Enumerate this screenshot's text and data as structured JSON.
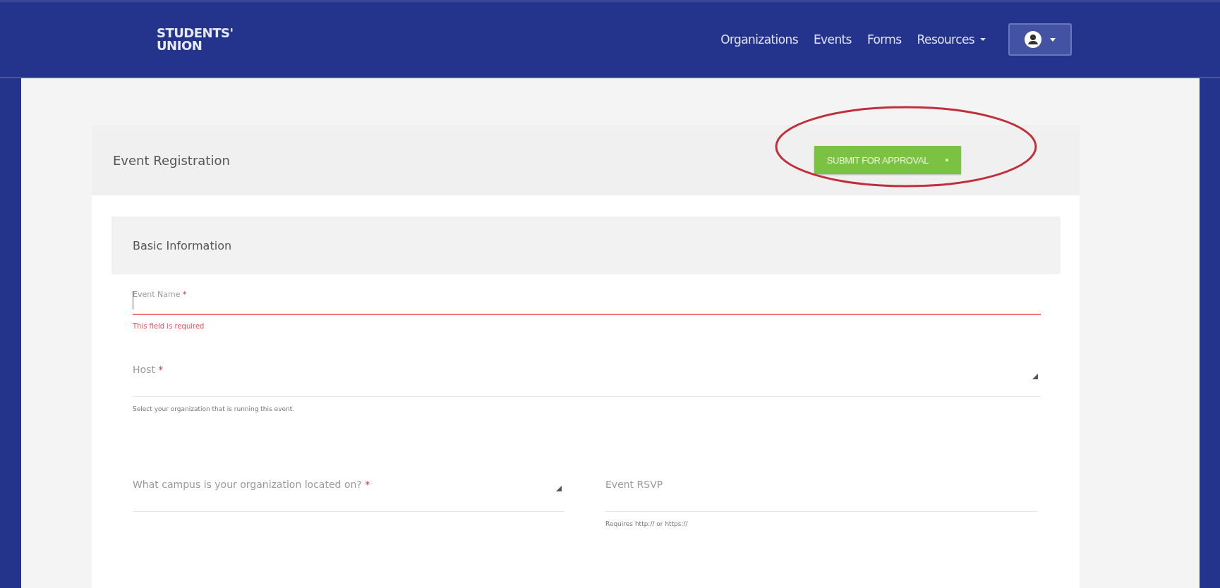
{
  "header": {
    "logo": {
      "line1": "STUDENTS'",
      "line2": "UNION"
    },
    "nav": [
      {
        "label": "Organizations",
        "kind": "link"
      },
      {
        "label": "Events",
        "kind": "link"
      },
      {
        "label": "Forms",
        "kind": "link"
      },
      {
        "label": "Resources",
        "kind": "dropdown"
      }
    ]
  },
  "page": {
    "title": "Event Registration",
    "action": {
      "label": "SUBMIT FOR APPROVAL",
      "annotated": true
    }
  },
  "section": {
    "title": "Basic Information",
    "rows": [
      [
        {
          "label": "Event Name",
          "required_mark": "*",
          "kind": "text",
          "invalid": true,
          "error": "This field is required"
        }
      ],
      [
        {
          "label": "Host",
          "required_mark": "*",
          "kind": "select",
          "invalid": false,
          "help": "Select your organization that is running this event."
        }
      ],
      [
        {
          "label": "What campus is your organization located on?",
          "required_mark": "*",
          "kind": "select",
          "invalid": false
        },
        {
          "label": "Event RSVP",
          "kind": "text",
          "invalid": false,
          "help": "Requires http:// or https://"
        }
      ]
    ]
  }
}
